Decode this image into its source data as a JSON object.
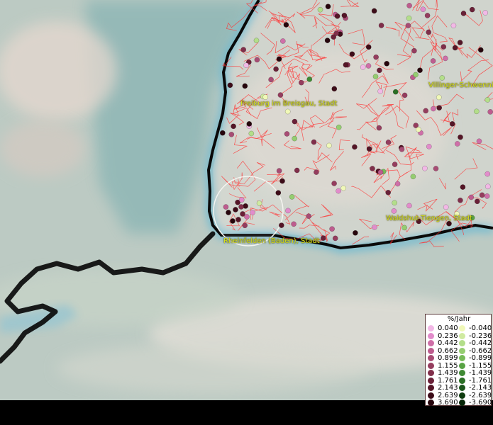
{
  "cities": [
    {
      "id": "freiburg",
      "name": "Freiburg im Breisgau, Stadt"
    },
    {
      "id": "villingen",
      "name": "Villinger-Schwennin"
    },
    {
      "id": "waldshut",
      "name": "Waldshut-Tiengen, Stadt"
    },
    {
      "id": "rheinfelden",
      "name": "Rheinfelden (Baden), Stadt"
    }
  ],
  "legend": {
    "title": "%/Jahr",
    "positive": [
      {
        "value": "0.040",
        "color": "#f2b8e6"
      },
      {
        "value": "0.236",
        "color": "#e28ccb"
      },
      {
        "value": "0.442",
        "color": "#cf6fa8"
      },
      {
        "value": "0.662",
        "color": "#bd5c8e"
      },
      {
        "value": "0.899",
        "color": "#a84c74"
      },
      {
        "value": "1.155",
        "color": "#953d5e"
      },
      {
        "value": "1.439",
        "color": "#802e4a"
      },
      {
        "value": "1.761",
        "color": "#6a2138"
      },
      {
        "value": "2.143",
        "color": "#541526"
      },
      {
        "value": "2.639",
        "color": "#3d0c18"
      },
      {
        "value": "3.690",
        "color": "#26050c"
      }
    ],
    "negative": [
      {
        "value": "-0.040",
        "color": "#f0f8b8"
      },
      {
        "value": "-0.236",
        "color": "#cfeaa0"
      },
      {
        "value": "-0.442",
        "color": "#b3de8a"
      },
      {
        "value": "-0.662",
        "color": "#95cd70"
      },
      {
        "value": "-0.899",
        "color": "#76ba58"
      },
      {
        "value": "-1.155",
        "color": "#58a344"
      },
      {
        "value": "-1.439",
        "color": "#3f8a34"
      },
      {
        "value": "-1.761",
        "color": "#2b6f26"
      },
      {
        "value": "-2.143",
        "color": "#1b551b"
      },
      {
        "value": "-2.639",
        "color": "#0f3d10"
      },
      {
        "value": "-3.690",
        "color": "#062507"
      }
    ]
  },
  "colors": {
    "terrain": "#c2cfc8",
    "lake": "#7fb0b2",
    "district_lines": "#ff3030",
    "border": "#0a0a0a",
    "river": "#4fb4d8",
    "label": "#d8e020"
  },
  "points": [
    {
      "v": 3.69
    },
    {
      "v": 1.155
    },
    {
      "v": -0.442
    },
    {
      "v": 0.662
    },
    {
      "v": 2.143
    },
    {
      "v": 0.236
    },
    {
      "v": 1.439
    },
    {
      "v": -1.155
    },
    {
      "v": 2.639
    },
    {
      "v": 0.442
    },
    {
      "v": 1.761
    },
    {
      "v": -0.236
    },
    {
      "v": 0.899
    },
    {
      "v": 3.69
    },
    {
      "v": 0.04
    },
    {
      "v": 1.155
    },
    {
      "v": 2.143
    },
    {
      "v": -0.662
    },
    {
      "v": 0.662
    },
    {
      "v": 1.439
    },
    {
      "v": 2.639
    },
    {
      "v": 0.236
    },
    {
      "v": -0.04
    },
    {
      "v": 1.761
    },
    {
      "v": 0.899
    },
    {
      "v": 3.69
    },
    {
      "v": 0.442
    },
    {
      "v": -1.439
    },
    {
      "v": 1.155
    },
    {
      "v": 2.143
    },
    {
      "v": 0.662
    },
    {
      "v": 0.04
    },
    {
      "v": 1.761
    },
    {
      "v": -0.899
    },
    {
      "v": 2.639
    },
    {
      "v": 0.899
    },
    {
      "v": 1.439
    },
    {
      "v": 0.236
    },
    {
      "v": 3.69
    },
    {
      "v": -0.442
    },
    {
      "v": 1.155
    },
    {
      "v": 0.662
    },
    {
      "v": 2.143
    },
    {
      "v": 0.442
    },
    {
      "v": -0.236
    },
    {
      "v": 1.761
    },
    {
      "v": 2.639
    },
    {
      "v": 0.899
    },
    {
      "v": 0.04
    },
    {
      "v": 3.69
    },
    {
      "v": -1.761
    },
    {
      "v": 1.439
    },
    {
      "v": 0.662
    },
    {
      "v": 2.143
    }
  ]
}
